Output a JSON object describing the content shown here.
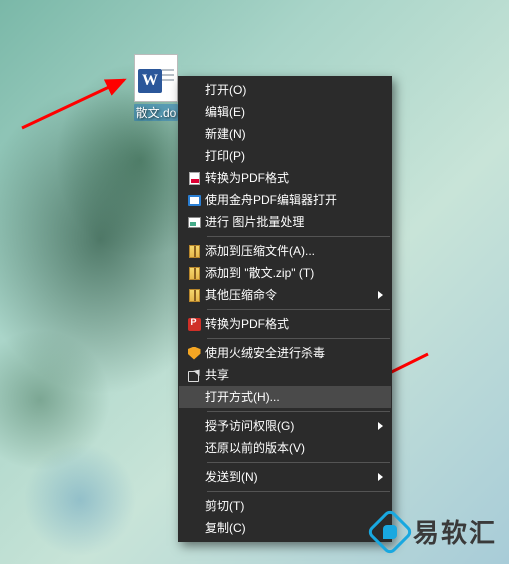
{
  "desktop": {
    "file": {
      "name": "散文.do"
    }
  },
  "context_menu": {
    "items": [
      {
        "label": "打开(O)",
        "icon": null
      },
      {
        "label": "编辑(E)",
        "icon": null
      },
      {
        "label": "新建(N)",
        "icon": null
      },
      {
        "label": "打印(P)",
        "icon": null
      },
      {
        "label": "转换为PDF格式",
        "icon": "pdf"
      },
      {
        "label": "使用金舟PDF编辑器打开",
        "icon": "pdfe"
      },
      {
        "label": "进行 图片批量处理",
        "icon": "img"
      },
      {
        "separator": true
      },
      {
        "label": "添加到压缩文件(A)...",
        "icon": "zip"
      },
      {
        "label": "添加到 \"散文.zip\" (T)",
        "icon": "zip"
      },
      {
        "label": "其他压缩命令",
        "icon": "zip",
        "submenu": true
      },
      {
        "separator": true
      },
      {
        "label": "转换为PDF格式",
        "icon": "pdf2"
      },
      {
        "separator": true
      },
      {
        "label": "使用火绒安全进行杀毒",
        "icon": "shield"
      },
      {
        "label": "共享",
        "icon": "share"
      },
      {
        "label": "打开方式(H)...",
        "icon": null,
        "highlight": true
      },
      {
        "separator": true
      },
      {
        "label": "授予访问权限(G)",
        "icon": null,
        "submenu": true
      },
      {
        "label": "还原以前的版本(V)",
        "icon": null
      },
      {
        "separator": true
      },
      {
        "label": "发送到(N)",
        "icon": null,
        "submenu": true
      },
      {
        "separator": true
      },
      {
        "label": "剪切(T)",
        "icon": null
      },
      {
        "label": "复制(C)",
        "icon": null
      }
    ]
  },
  "watermark": {
    "text": "易软汇"
  },
  "colors": {
    "menu_bg": "#2b2b2b",
    "highlight": "#4a4a4a",
    "arrow": "#ff0000",
    "brand": "#19a8e0"
  }
}
